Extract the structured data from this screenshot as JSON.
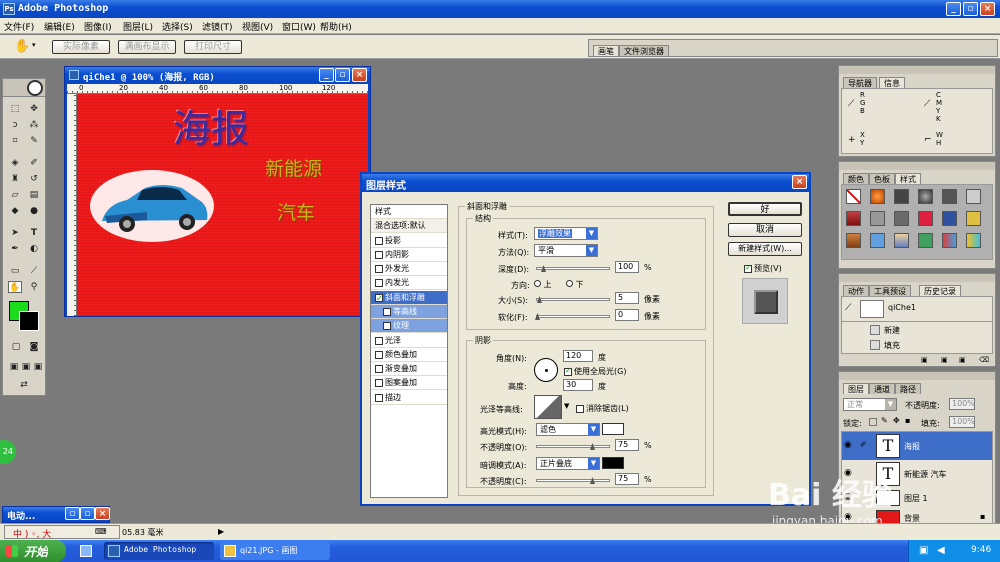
{
  "app": {
    "title": "Adobe Photoshop"
  },
  "menu": [
    "文件(F)",
    "编辑(E)",
    "图像(I)",
    "图层(L)",
    "选择(S)",
    "滤镜(T)",
    "视图(V)",
    "窗口(W)",
    "帮助(H)"
  ],
  "options_bar": {
    "buttons": [
      "实际像素",
      "满画布显示",
      "打印尺寸"
    ]
  },
  "dock_tabs": [
    "画笔",
    "文件浏览器"
  ],
  "document": {
    "title": "qiChe1 @ 100% (海报, RGB)",
    "ruler_ticks": [
      "0",
      "20",
      "40",
      "60",
      "80",
      "100",
      "120"
    ],
    "poster_title": "海报",
    "poster_line1": "新能源",
    "poster_line2": "汽车",
    "bg_color": "#f01b1b"
  },
  "dialog": {
    "title": "图层样式",
    "style_list": [
      {
        "label": "样式",
        "kind": "header"
      },
      {
        "label": "混合选项:默认",
        "kind": "header"
      },
      {
        "label": "投影",
        "checked": false
      },
      {
        "label": "内阴影",
        "checked": false
      },
      {
        "label": "外发光",
        "checked": false
      },
      {
        "label": "内发光",
        "checked": false
      },
      {
        "label": "斜面和浮雕",
        "checked": true,
        "selected": true
      },
      {
        "label": "等高线",
        "checked": false,
        "sub": true
      },
      {
        "label": "纹理",
        "checked": false,
        "sub": true
      },
      {
        "label": "光泽",
        "checked": false
      },
      {
        "label": "颜色叠加",
        "checked": false
      },
      {
        "label": "渐变叠加",
        "checked": false
      },
      {
        "label": "图案叠加",
        "checked": false
      },
      {
        "label": "描边",
        "checked": false
      }
    ],
    "section_title": "斜面和浮雕",
    "structure": {
      "group_title": "结构",
      "style_label": "样式(T):",
      "style_value": "浮雕效果",
      "method_label": "方法(Q):",
      "method_value": "平滑",
      "depth_label": "深度(D):",
      "depth_value": "100",
      "depth_unit": "%",
      "depth_level": 0.1,
      "direction_label": "方向:",
      "dir_up": "上",
      "dir_down": "下",
      "size_label": "大小(S):",
      "size_value": "5",
      "size_unit": "像素",
      "size_level": 0.02,
      "soften_label": "软化(F):",
      "soften_value": "0",
      "soften_unit": "像素",
      "soften_level": 0
    },
    "shading": {
      "group_title": "阴影",
      "angle_label": "角度(N):",
      "angle_value": "120",
      "angle_unit": "度",
      "global_light_label": "使用全局光(G)",
      "global_light": true,
      "altitude_label": "高度:",
      "altitude_value": "30",
      "altitude_unit": "度",
      "gloss_label": "光泽等高线:",
      "anti_alias_label": "消除锯齿(L)",
      "highlight_label": "高光模式(H):",
      "highlight_value": "滤色",
      "highlight_color": "#ffffff",
      "hl_opacity_label": "不透明度(O):",
      "hl_opacity_value": "75",
      "hl_opacity_unit": "%",
      "hl_opacity_level": 0.75,
      "shadow_label": "暗调模式(A):",
      "shadow_value": "正片叠底",
      "shadow_color": "#000000",
      "sh_opacity_label": "不透明度(C):",
      "sh_opacity_value": "75",
      "sh_opacity_unit": "%",
      "sh_opacity_level": 0.75
    },
    "buttons": {
      "ok": "好",
      "cancel": "取消",
      "new_style": "新建样式(W)...",
      "preview": "预览(V)"
    }
  },
  "panels": {
    "nav_tabs": [
      "导航器",
      "信息"
    ],
    "info": {
      "rgb": "R\nG\nB",
      "cmyk": "C\nM\nY\nK",
      "xy": "X\nY",
      "wh": "W\nH",
      "colon2": ":\n:"
    },
    "swatch_tabs": [
      "颜色",
      "色板",
      "样式"
    ],
    "history_tabs": [
      "动作",
      "工具预设",
      "历史记录"
    ],
    "history": {
      "snapshot": "qiChe1",
      "items": [
        "新建",
        "填充"
      ]
    },
    "layer_tabs": [
      "图层",
      "通道",
      "路径"
    ],
    "layers": {
      "blend_mode": "正常",
      "opacity_label": "不透明度:",
      "opacity_value": "100%",
      "lock_label": "锁定:",
      "fill_label": "填充:",
      "fill_value": "100%",
      "items": [
        {
          "name": "海报",
          "thumb": "T",
          "selected": true
        },
        {
          "name": "新能源 汽车",
          "thumb": "T",
          "selected": false
        },
        {
          "name": "图层 1",
          "thumb": "",
          "selected": false
        },
        {
          "name": "背景",
          "thumb": "",
          "selected": false
        }
      ]
    }
  },
  "mini_window": {
    "title": "电动...",
    "status": "05.83 毫米"
  },
  "ime": {
    "text": "中 ) ◦, 大"
  },
  "taskbar": {
    "start": "开始",
    "tasks": [
      "Adobe Photoshop",
      "qi21.JPG - 画图"
    ],
    "clock": "9:46",
    "green_badge": "24"
  },
  "watermark": {
    "brand": "Bai 经验",
    "url": "jingyan.baidu.com"
  }
}
